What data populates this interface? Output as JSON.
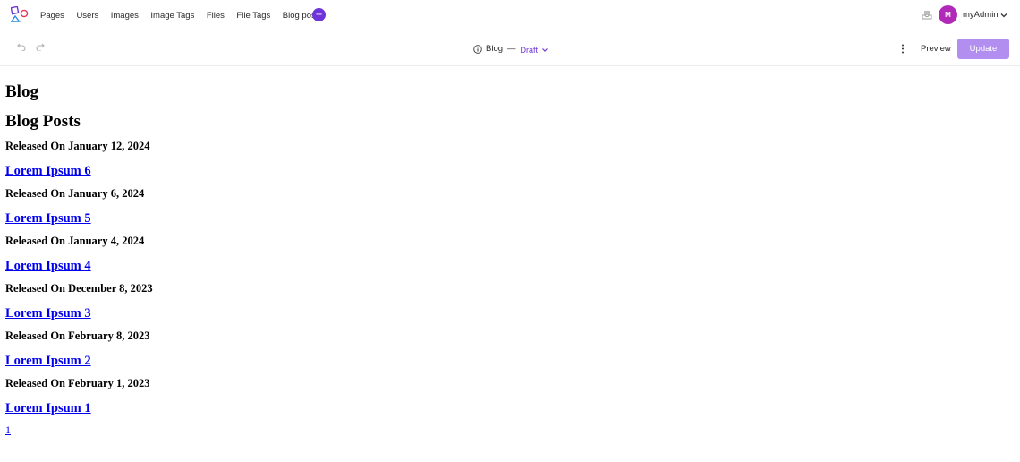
{
  "nav": {
    "items": [
      "Pages",
      "Users",
      "Images",
      "Image Tags",
      "Files",
      "File Tags",
      "Blog post"
    ],
    "add_icon": "plus-icon",
    "accent": "#6d35d9"
  },
  "user": {
    "initial": "M",
    "name": "myAdmin",
    "avatar_color": "#b02ab7"
  },
  "toolbar": {
    "title": "Blog",
    "dash": "—",
    "status": "Draft",
    "preview_label": "Preview",
    "update_label": "Update",
    "update_color": "#b18ef0"
  },
  "content": {
    "heading": "Blog",
    "subheading": "Blog Posts",
    "posts": [
      {
        "date": "Released On January 12, 2024",
        "title": "Lorem Ipsum 6"
      },
      {
        "date": "Released On January 6, 2024",
        "title": "Lorem Ipsum 5"
      },
      {
        "date": "Released On January 4, 2024",
        "title": "Lorem Ipsum 4"
      },
      {
        "date": "Released On December 8, 2023",
        "title": "Lorem Ipsum 3"
      },
      {
        "date": "Released On February 8, 2023",
        "title": "Lorem Ipsum 2"
      },
      {
        "date": "Released On February 1, 2023",
        "title": "Lorem Ipsum 1"
      }
    ],
    "pagination": [
      "1"
    ],
    "link_color": "#0000ee"
  }
}
